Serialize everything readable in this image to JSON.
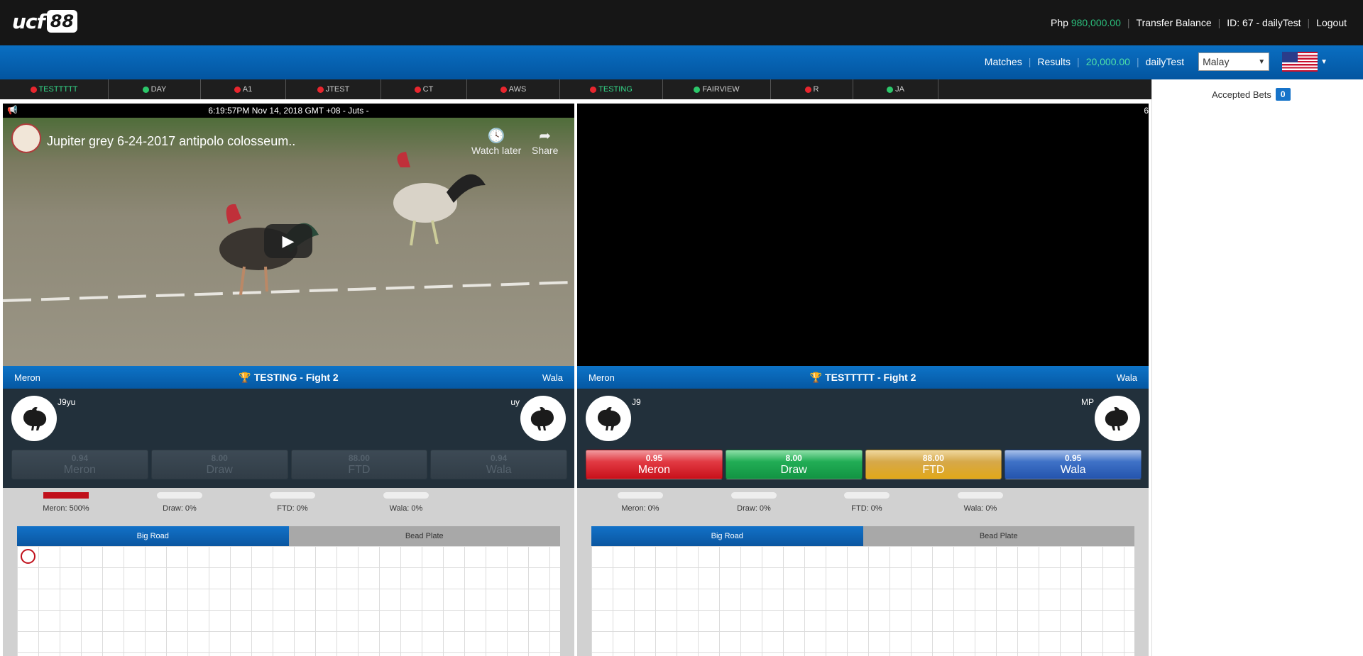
{
  "header": {
    "logo_text": "ucf",
    "logo_num": "88",
    "currency_label": "Php",
    "balance": "980,000.00",
    "transfer_label": "Transfer Balance",
    "user_id": "ID: 67 - dailyTest",
    "logout_label": "Logout"
  },
  "nav": {
    "matches_label": "Matches",
    "results_label": "Results",
    "credit": "20,000.00",
    "username": "dailyTest",
    "language": "Malay",
    "flag_icon": "us-flag-icon"
  },
  "arenas": [
    {
      "name": "TESTTTTT",
      "status": "red",
      "active": true
    },
    {
      "name": "DAY",
      "status": "green",
      "active": false
    },
    {
      "name": "A1",
      "status": "red",
      "active": false
    },
    {
      "name": "JTEST",
      "status": "red",
      "active": false
    },
    {
      "name": "CT",
      "status": "red",
      "active": false
    },
    {
      "name": "AWS",
      "status": "red",
      "active": false
    },
    {
      "name": "TESTING",
      "status": "red",
      "active": true
    },
    {
      "name": "FAIRVIEW",
      "status": "green",
      "active": false
    },
    {
      "name": "R",
      "status": "red",
      "active": false
    },
    {
      "name": "JA",
      "status": "green",
      "active": false
    }
  ],
  "side": {
    "accepted_label": "Accepted Bets",
    "accepted_count": "0"
  },
  "fights": [
    {
      "time": "6:19:57PM Nov 14, 2018 GMT +08 - Juts -",
      "video_title": "Jupiter grey 6-24-2017 antipolo colosseum..",
      "watch_later": "Watch later",
      "share": "Share",
      "meron_label": "Meron",
      "wala_label": "Wala",
      "fight_title": "TESTING - Fight 2",
      "meron_name": "J9yu",
      "wala_name": "uy",
      "odds": [
        {
          "value": "0.94",
          "label": "Meron"
        },
        {
          "value": "8.00",
          "label": "Draw"
        },
        {
          "value": "88.00",
          "label": "FTD"
        },
        {
          "value": "0.94",
          "label": "Wala"
        }
      ],
      "enabled": false,
      "stats": [
        "Meron: 500%",
        "Draw: 0%",
        "FTD: 0%",
        "Wala: 0%"
      ],
      "big_road": "Big Road",
      "bead_plate": "Bead Plate"
    },
    {
      "time": "6",
      "video_title": "",
      "watch_later": "",
      "share": "",
      "meron_label": "Meron",
      "wala_label": "Wala",
      "fight_title": "TESTTTTT - Fight 2",
      "meron_name": "J9",
      "wala_name": "MP",
      "odds": [
        {
          "value": "0.95",
          "label": "Meron"
        },
        {
          "value": "8.00",
          "label": "Draw"
        },
        {
          "value": "88.00",
          "label": "FTD"
        },
        {
          "value": "0.95",
          "label": "Wala"
        }
      ],
      "enabled": true,
      "stats": [
        "Meron: 0%",
        "Draw: 0%",
        "FTD: 0%",
        "Wala: 0%"
      ],
      "big_road": "Big Road",
      "bead_plate": "Bead Plate"
    }
  ]
}
